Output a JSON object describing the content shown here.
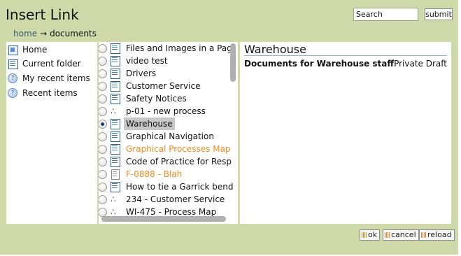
{
  "dialog": {
    "title": "Insert Link",
    "search": {
      "value": "Search",
      "submit_label": "submit"
    },
    "breadcrumb": {
      "home": "home",
      "separator": "→",
      "current": "documents"
    }
  },
  "left_nav": [
    {
      "label": "Home",
      "icon": "home-icon"
    },
    {
      "label": "Current folder",
      "icon": "folder-page-icon"
    },
    {
      "label": "My recent items",
      "icon": "recent-icon"
    },
    {
      "label": "Recent items",
      "icon": "recent-icon"
    }
  ],
  "items": [
    {
      "label": "Files and Images in a Pag",
      "icon": "page",
      "selected": false,
      "highlight": false
    },
    {
      "label": "video test",
      "icon": "page",
      "selected": false,
      "highlight": false
    },
    {
      "label": "Drivers",
      "icon": "page",
      "selected": false,
      "highlight": false
    },
    {
      "label": "Customer Service",
      "icon": "page",
      "selected": false,
      "highlight": false
    },
    {
      "label": "Safety Notices",
      "icon": "page",
      "selected": false,
      "highlight": false
    },
    {
      "label": "p-01 - new process",
      "icon": "process",
      "selected": false,
      "highlight": false
    },
    {
      "label": "Warehouse",
      "icon": "page",
      "selected": true,
      "highlight": false
    },
    {
      "label": "Graphical Navigation",
      "icon": "page",
      "selected": false,
      "highlight": false
    },
    {
      "label": "Graphical Processes Map",
      "icon": "page",
      "selected": false,
      "highlight": true
    },
    {
      "label": "Code of Practice for Resp",
      "icon": "page",
      "selected": false,
      "highlight": false
    },
    {
      "label": "F-0888 - Blah",
      "icon": "file",
      "selected": false,
      "highlight": true
    },
    {
      "label": "How to tie a Garrick bend",
      "icon": "page",
      "selected": false,
      "highlight": false
    },
    {
      "label": "234 - Customer Service",
      "icon": "process",
      "selected": false,
      "highlight": false
    },
    {
      "label": "WI-475 - Process Map",
      "icon": "process",
      "selected": false,
      "highlight": false
    }
  ],
  "detail": {
    "title": "Warehouse",
    "description": "Documents for Warehouse staff",
    "status": "Private Draft"
  },
  "footer": {
    "ok": "ok",
    "cancel": "cancel",
    "reload": "reload"
  },
  "colors": {
    "dialog_bg": "#d0d9a8",
    "highlight_text": "#f08a1a",
    "selected_bg": "#c8c8c8"
  }
}
